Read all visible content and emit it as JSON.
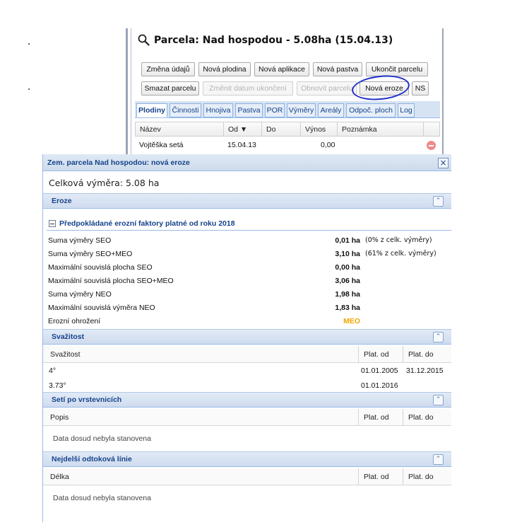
{
  "parcel_window": {
    "title": "Parcela: Nad hospodou - 5.08ha (15.04.13)",
    "buttons_row1": [
      "Změna údajů",
      "Nová plodina",
      "Nová aplikace",
      "Nová pastva",
      "Ukončit parcelu"
    ],
    "buttons_row2": [
      "Smazat parcelu",
      "Změnit datum ukončení",
      "Obnovit parcelu",
      "Nová eroze",
      "NS"
    ],
    "tabs": [
      "Plodiny",
      "Činnosti",
      "Hnojiva",
      "Pastva",
      "POR",
      "Výměry",
      "Areály",
      "Odpoč. ploch",
      "Log"
    ],
    "active_tab": "Plodiny",
    "columns": [
      "Název",
      "Od ▼",
      "Do",
      "Výnos",
      "Poznámka"
    ],
    "rows": [
      {
        "nazev": "Vojtěška setá",
        "od": "15.04.13",
        "do": "",
        "vynos": "0,00",
        "poznamka": ""
      }
    ]
  },
  "dialog": {
    "title": "Zem. parcela Nad hospodou: nová eroze",
    "total_area": "Celková výměra: 5.08 ha",
    "sections": {
      "eroze": {
        "title": "Eroze",
        "fieldset_title": "Předpokládané erozní faktory platné od roku 2018",
        "rows": [
          {
            "label": "Suma výměry SEO",
            "value": "0,01 ha",
            "note": "(0% z celk. výměry)"
          },
          {
            "label": "Suma výměry SEO+MEO",
            "value": "3,10 ha",
            "note": "(61% z celk. výměry)"
          },
          {
            "label": "Maximální souvislá plocha SEO",
            "value": "0,00 ha",
            "note": ""
          },
          {
            "label": "Maximální souvislá plocha SEO+MEO",
            "value": "3,06 ha",
            "note": ""
          },
          {
            "label": "Suma výměry NEO",
            "value": "1,98 ha",
            "note": ""
          },
          {
            "label": "Maximální souvislá výměra NEO",
            "value": "1,83 ha",
            "note": ""
          },
          {
            "label": "Erozní ohrožení",
            "value": "MEO",
            "note": ""
          }
        ]
      },
      "svazitost": {
        "title": "Svažitost",
        "columns": [
          "Svažitost",
          "Plat. od",
          "Plat. do"
        ],
        "rows": [
          {
            "value": "4°",
            "od": "01.01.2005",
            "do": "31.12.2015"
          },
          {
            "value": "3.73°",
            "od": "01.01.2016",
            "do": ""
          }
        ]
      },
      "seti": {
        "title": "Setí po vrstevnicích",
        "columns": [
          "Popis",
          "Plat. od",
          "Plat. do"
        ],
        "empty_text": "Data dosud nebyla stanovena"
      },
      "linie": {
        "title": "Nejdelší odtoková línie",
        "columns": [
          "Délka",
          "Plat. od",
          "Plat. do"
        ],
        "empty_text": "Data dosud nebyla stanovena"
      }
    }
  },
  "colors": {
    "header_text": "#15428b",
    "section_bg": "#d9e5f3",
    "annotation_circle": "#1f2fc9",
    "meo_value": "#f4a300",
    "delete_icon": "#ee8a8a"
  },
  "icons": [
    "search-icon",
    "delete-row-icon",
    "close-icon",
    "collapse-icon",
    "fieldset-collapse-icon"
  ]
}
